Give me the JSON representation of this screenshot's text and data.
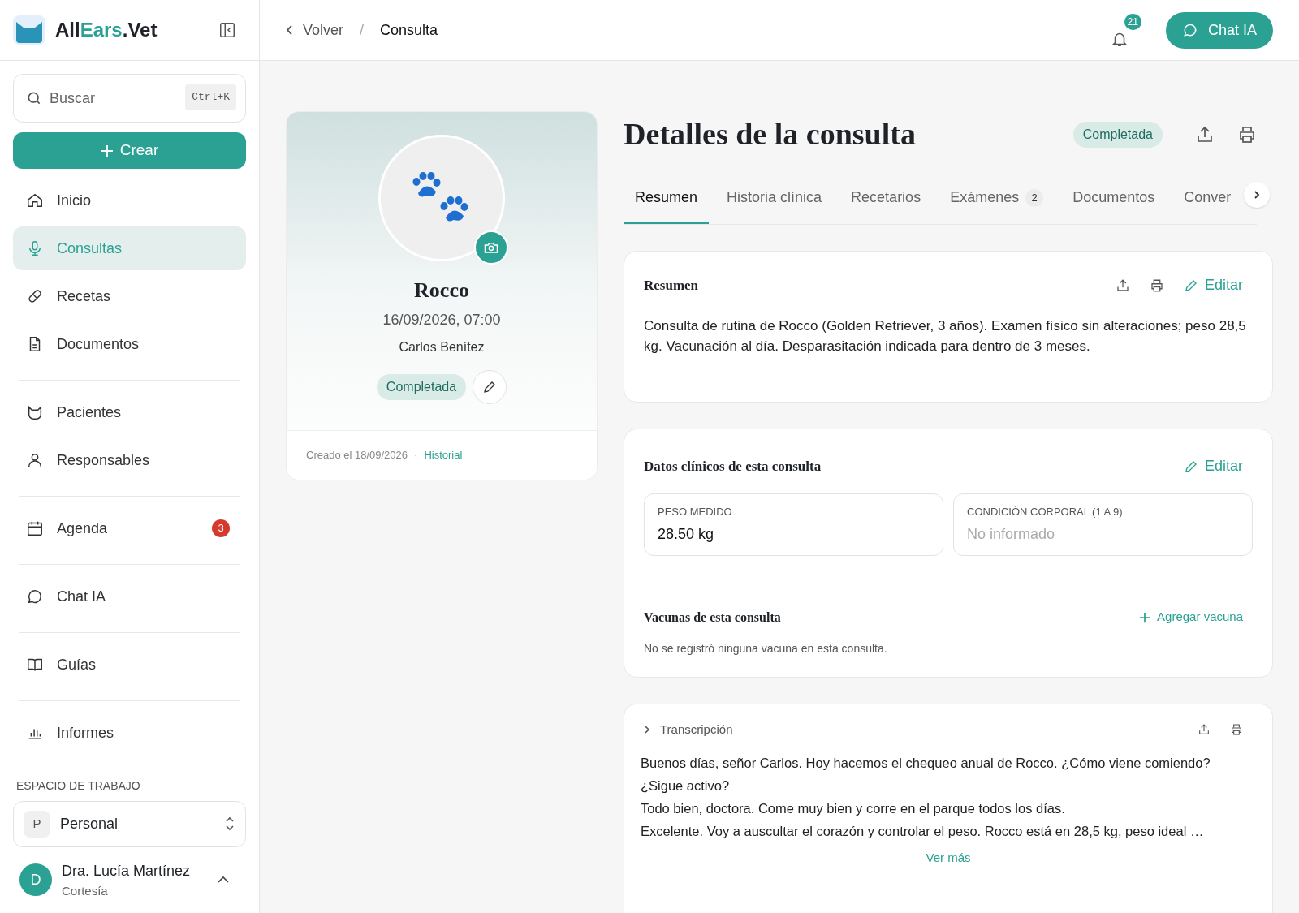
{
  "brand": {
    "prefix": "All",
    "highlight": "Ears",
    "suffix": ".Vet"
  },
  "search": {
    "placeholder": "Buscar",
    "shortcut": "Ctrl+K"
  },
  "create_button": {
    "label": "Crear"
  },
  "sidebar": {
    "groups": [
      {
        "items": [
          {
            "label": "Inicio",
            "selected": false
          },
          {
            "label": "Consultas",
            "selected": true
          },
          {
            "label": "Recetas",
            "selected": false
          },
          {
            "label": "Documentos",
            "selected": false
          }
        ]
      },
      {
        "items": [
          {
            "label": "Pacientes",
            "selected": false
          },
          {
            "label": "Responsables",
            "selected": false
          }
        ]
      },
      {
        "items": [
          {
            "label": "Agenda",
            "selected": false,
            "badge": "3"
          }
        ]
      },
      {
        "items": [
          {
            "label": "Chat IA",
            "selected": false
          }
        ]
      },
      {
        "items": [
          {
            "label": "Guías",
            "selected": false
          }
        ]
      },
      {
        "items": [
          {
            "label": "Informes",
            "selected": false
          }
        ]
      }
    ]
  },
  "workspace": {
    "heading": "ESPACIO DE TRABAJO",
    "initial": "P",
    "name": "Personal"
  },
  "user": {
    "initial": "D",
    "name": "Dra. Lucía Martínez",
    "plan": "Cortesía"
  },
  "breadcrumb": {
    "back": "Volver",
    "separator": "/",
    "current": "Consulta"
  },
  "notifications": {
    "count": "21"
  },
  "chat_button": {
    "label": "Chat IA"
  },
  "patient": {
    "name": "Rocco",
    "datetime": "16/09/2026, 07:00",
    "owner": "Carlos Benítez",
    "status": "Completada",
    "created": "Creado el 18/09/2026",
    "separator": "·",
    "history_link": "Historial"
  },
  "page": {
    "title": "Detalles de la consulta",
    "status": "Completada"
  },
  "tabs": [
    {
      "label": "Resumen",
      "selected": true
    },
    {
      "label": "Historia clínica",
      "selected": false
    },
    {
      "label": "Recetarios",
      "selected": false
    },
    {
      "label": "Exámenes",
      "selected": false,
      "count": "2"
    },
    {
      "label": "Documentos",
      "selected": false
    },
    {
      "label": "Conver",
      "selected": false
    }
  ],
  "summary": {
    "title": "Resumen",
    "edit": "Editar",
    "text": "Consulta de rutina de Rocco (Golden Retriever, 3 años). Examen físico sin alteraciones; peso 28,5 kg. Vacunación al día. Desparasitación indicada para dentro de 3 meses."
  },
  "clinical": {
    "title": "Datos clínicos de esta consulta",
    "edit": "Editar",
    "fields": [
      {
        "label": "PESO MEDIDO",
        "value": "28.50 kg",
        "informed": true
      },
      {
        "label": "CONDICIÓN CORPORAL (1 A 9)",
        "value": "No informado",
        "informed": false
      }
    ],
    "vaccines": {
      "title": "Vacunas de esta consulta",
      "add": "Agregar vacuna",
      "empty": "No se registró ninguna vacuna en esta consulta."
    }
  },
  "transcript": {
    "title": "Transcripción",
    "expanded": false,
    "lines": [
      "Buenos días, señor Carlos. Hoy hacemos el chequeo anual de Rocco. ¿Cómo viene comiendo? ¿Sigue activo?",
      "Todo bien, doctora. Come muy bien y corre en el parque todos los días.",
      "Excelente. Voy a auscultar el corazón y controlar el peso. Rocco está en 28,5 kg, peso ideal …"
    ],
    "more": "Ver más"
  }
}
